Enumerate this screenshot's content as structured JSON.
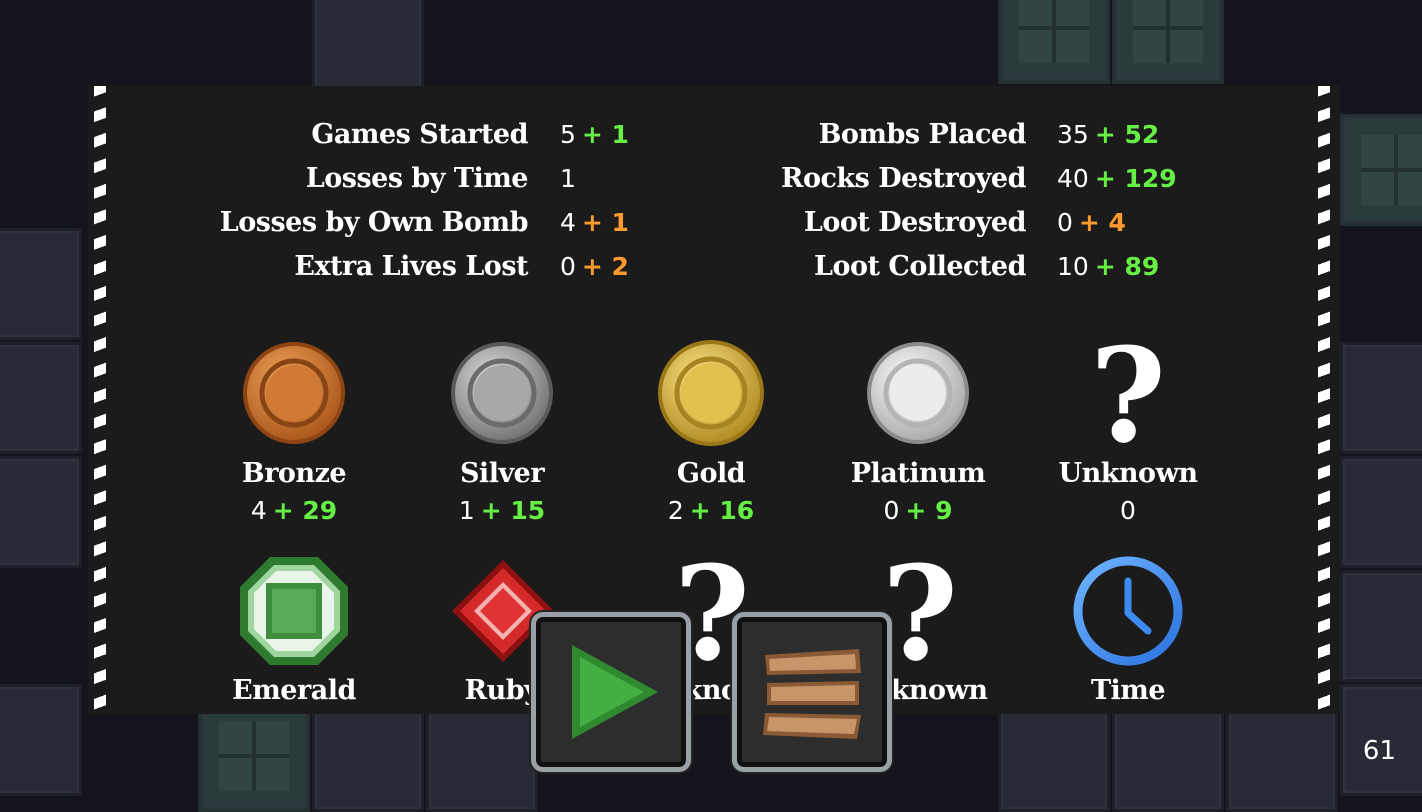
{
  "stats_left": [
    {
      "label": "Games Started",
      "value": "5",
      "delta": "+ 1",
      "delta_color": "green"
    },
    {
      "label": "Losses by Time",
      "value": "1",
      "delta": "",
      "delta_color": ""
    },
    {
      "label": "Losses by Own Bomb",
      "value": "4",
      "delta": "+ 1",
      "delta_color": "orange"
    },
    {
      "label": "Extra Lives Lost",
      "value": "0",
      "delta": "+ 2",
      "delta_color": "orange"
    }
  ],
  "stats_right": [
    {
      "label": "Bombs Placed",
      "value": "35",
      "delta": "+ 52",
      "delta_color": "green"
    },
    {
      "label": "Rocks Destroyed",
      "value": "40",
      "delta": "+ 129",
      "delta_color": "green"
    },
    {
      "label": "Loot Destroyed",
      "value": "0",
      "delta": "+ 4",
      "delta_color": "orange"
    },
    {
      "label": "Loot Collected",
      "value": "10",
      "delta": "+ 89",
      "delta_color": "green"
    }
  ],
  "coins": [
    {
      "name": "Bronze",
      "value": "4",
      "delta": "+ 29",
      "icon": "bronze-coin-icon"
    },
    {
      "name": "Silver",
      "value": "1",
      "delta": "+ 15",
      "icon": "silver-coin-icon"
    },
    {
      "name": "Gold",
      "value": "2",
      "delta": "+ 16",
      "icon": "gold-coin-icon"
    },
    {
      "name": "Platinum",
      "value": "0",
      "delta": "+ 9",
      "icon": "platinum-coin-icon"
    },
    {
      "name": "Unknown",
      "value": "0",
      "delta": "",
      "icon": "question-mark-icon"
    }
  ],
  "gems": [
    {
      "name": "Emerald",
      "icon": "emerald-gem-icon"
    },
    {
      "name": "Ruby",
      "icon": "ruby-gem-icon"
    },
    {
      "name": "Unknown",
      "icon": "question-mark-icon"
    },
    {
      "name": "Unknown",
      "icon": "question-mark-icon"
    },
    {
      "name": "Time",
      "icon": "clock-icon"
    }
  ],
  "question_mark": "?",
  "buttons": {
    "play_icon": "play-triangle-icon",
    "menu_icon": "wooden-planks-menu-icon"
  },
  "colors": {
    "green": "#66f046",
    "orange": "#ff9a2e"
  },
  "page_number": "61"
}
